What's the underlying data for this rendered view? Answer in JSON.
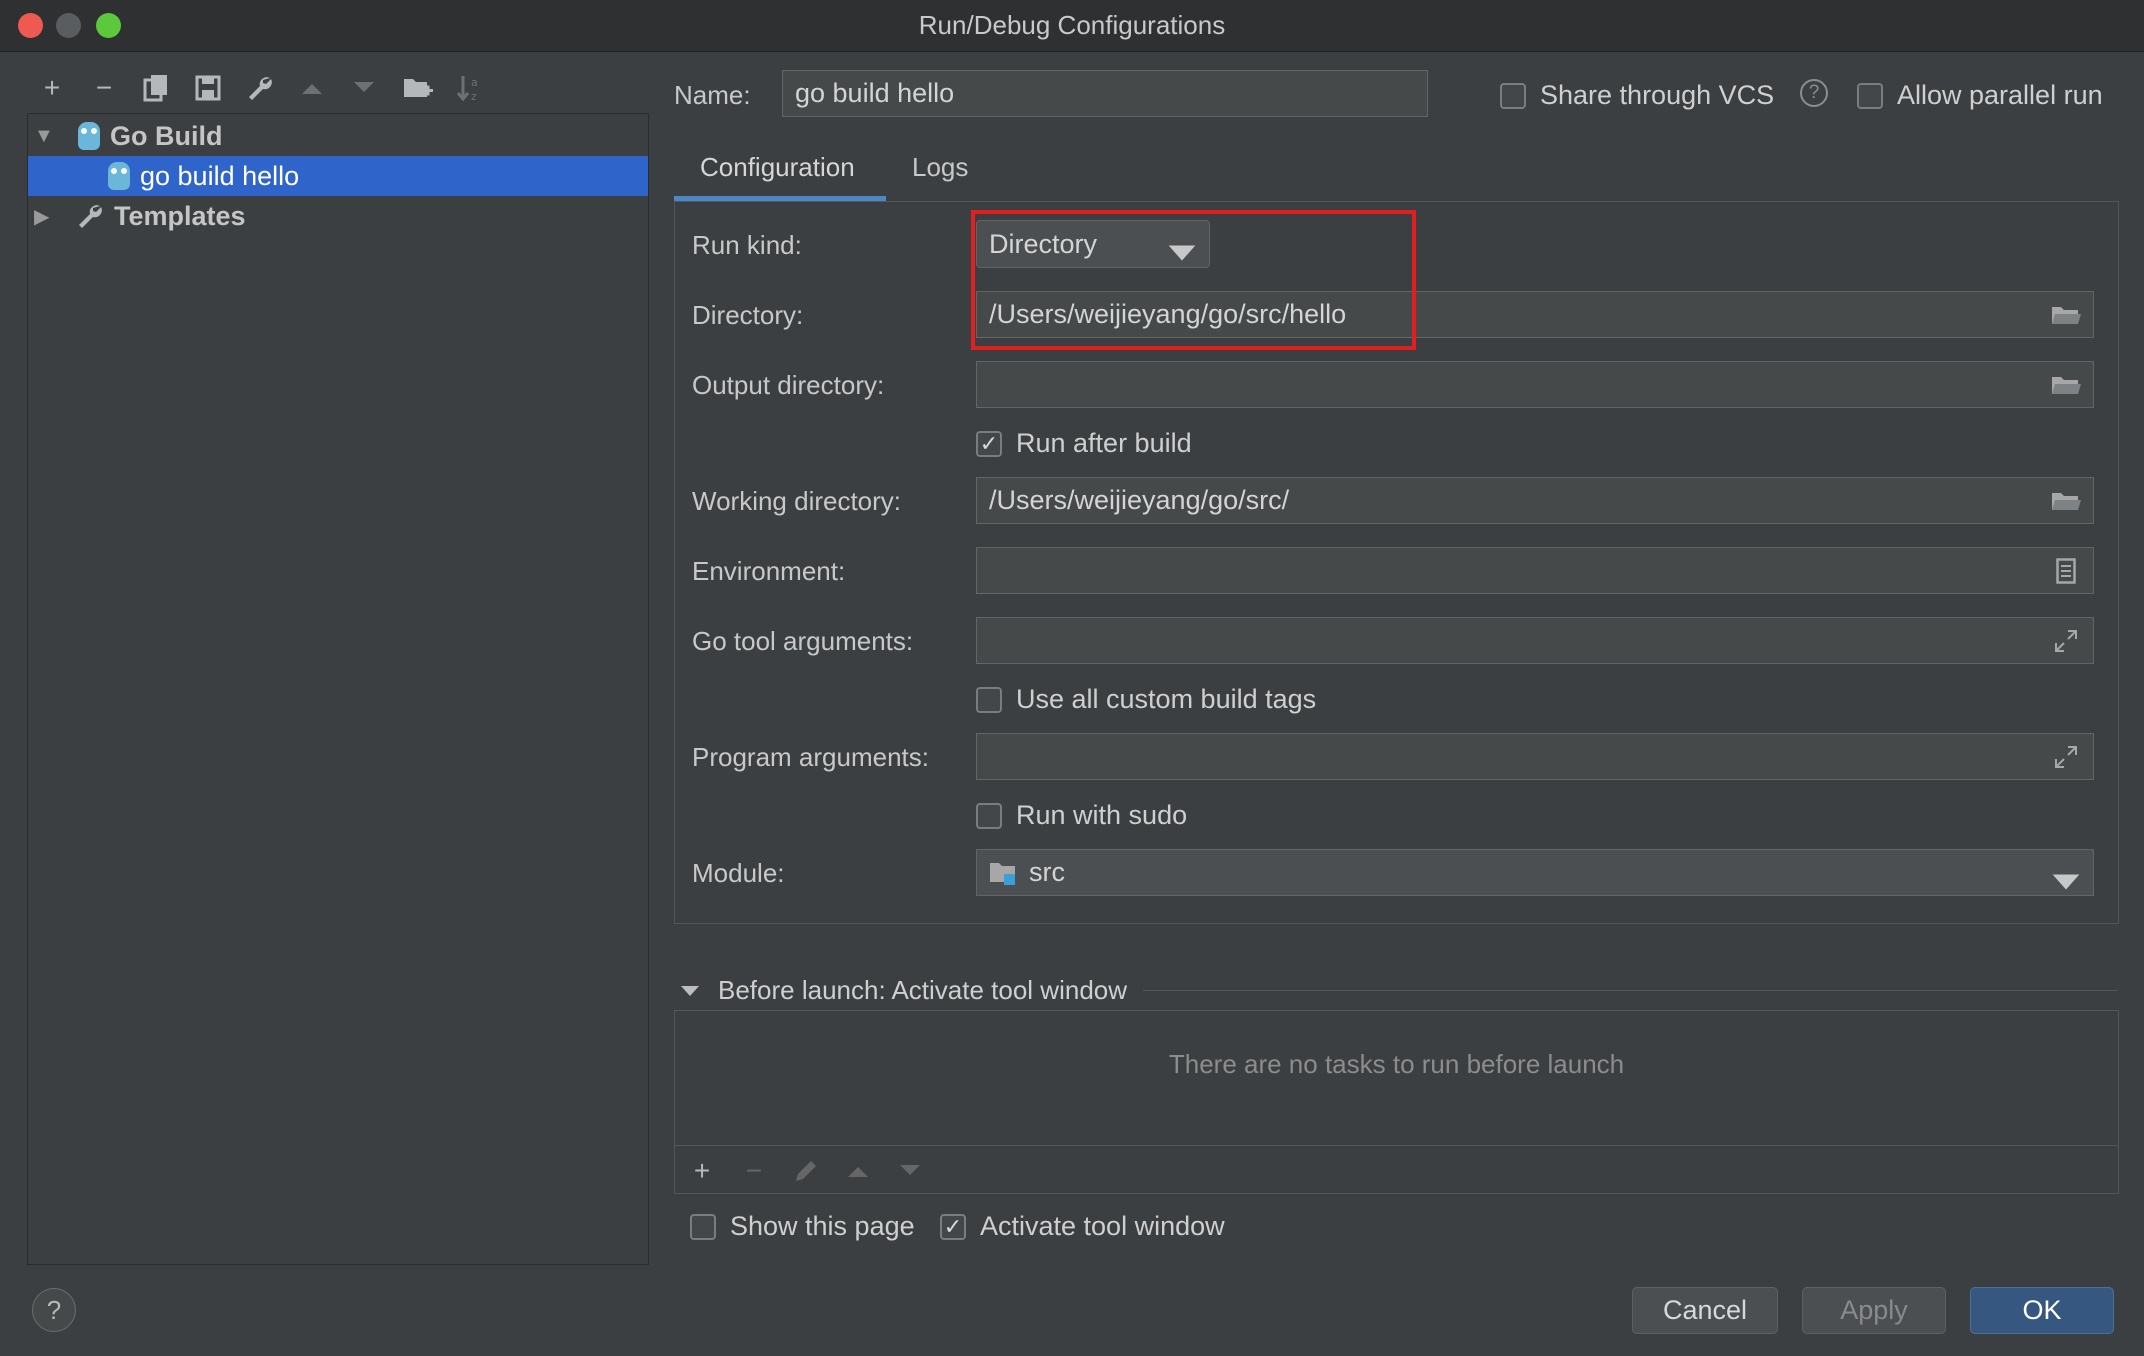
{
  "window": {
    "title": "Run/Debug Configurations",
    "traffic_colors": [
      "#ee5a52",
      "#f5be4f",
      "#5cc83b"
    ]
  },
  "toolbar": {
    "icons": [
      "add-icon",
      "remove-icon",
      "copy-icon",
      "save-icon",
      "wrench-icon",
      "move-up-icon",
      "move-down-icon",
      "new-folder-icon",
      "sort-icon"
    ]
  },
  "tree": {
    "group_label": "Go Build",
    "selected_item": "go build hello",
    "templates_label": "Templates"
  },
  "header": {
    "name_label": "Name:",
    "name_value": "go build hello",
    "share_vcs_label": "Share through VCS",
    "allow_parallel_label": "Allow parallel run"
  },
  "tabs": [
    "Configuration",
    "Logs"
  ],
  "form": {
    "run_kind_label": "Run kind:",
    "run_kind_value": "Directory",
    "directory_label": "Directory:",
    "directory_value": "/Users/weijieyang/go/src/hello",
    "output_dir_label": "Output directory:",
    "output_dir_value": "",
    "run_after_build_label": "Run after build",
    "run_after_build_checked": true,
    "working_dir_label": "Working directory:",
    "working_dir_value": "/Users/weijieyang/go/src/",
    "environment_label": "Environment:",
    "environment_value": "",
    "go_tool_args_label": "Go tool arguments:",
    "go_tool_args_value": "",
    "custom_tags_label": "Use all custom build tags",
    "program_args_label": "Program arguments:",
    "program_args_value": "",
    "run_sudo_label": "Run with sudo",
    "module_label": "Module:",
    "module_value": "src"
  },
  "before_launch": {
    "header": "Before launch: Activate tool window",
    "empty_text": "There are no tasks to run before launch",
    "show_page_label": "Show this page",
    "activate_tool_label": "Activate tool window"
  },
  "buttons": {
    "cancel": "Cancel",
    "apply": "Apply",
    "ok": "OK",
    "help": "?"
  },
  "colors": {
    "selection": "#2f65ca",
    "highlight_box": "#e0201e",
    "tab_underline": "#4a88c7",
    "ok_button": "#365880"
  }
}
